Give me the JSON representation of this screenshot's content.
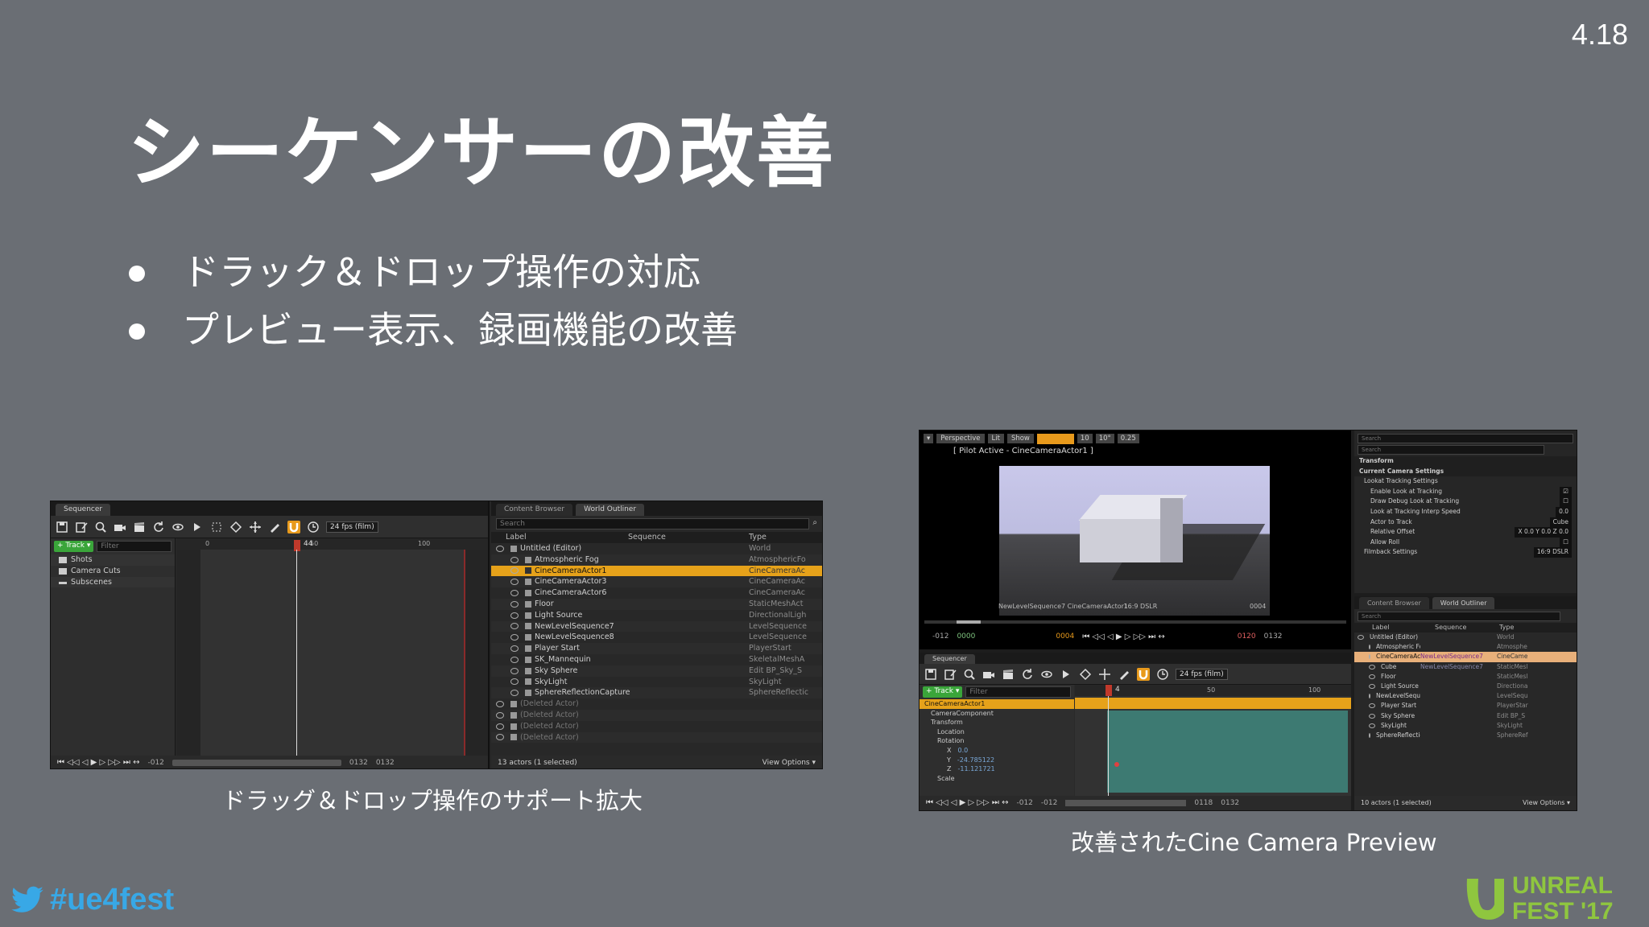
{
  "version": "4.18",
  "title": "シーケンサーの改善",
  "bullets": [
    "ドラック＆ドロップ操作の対応",
    "プレビュー表示、録画機能の改善"
  ],
  "captions": {
    "left": "ドラッグ＆ドロップ操作のサポート拡大",
    "right": "改善されたCine Camera Preview"
  },
  "hashtag": "#ue4fest",
  "logo_text": [
    "UNREAL",
    "FEST '17"
  ],
  "shot1": {
    "tabs": {
      "sequencer": "Sequencer",
      "content_browser": "Content Browser",
      "world_outliner": "World Outliner"
    },
    "fps": "24 fps (film)",
    "track_button": "+ Track ▾",
    "filter_placeholder": "Filter",
    "tracks": [
      "Shots",
      "Camera Cuts",
      "Subscenes"
    ],
    "ruler": {
      "start": "0",
      "frame": "44",
      "m50": "50",
      "m100": "100"
    },
    "timecodes": {
      "start": "-012",
      "end1": "0132",
      "end2": "0132"
    },
    "outliner": {
      "search_placeholder": "Search",
      "headers": {
        "label": "Label",
        "sequence": "Sequence",
        "type": "Type"
      },
      "rows": [
        {
          "label": "Untitled (Editor)",
          "type": "World",
          "indent": 0
        },
        {
          "label": "Atmospheric Fog",
          "type": "AtmosphericFo",
          "indent": 1
        },
        {
          "label": "CineCameraActor1",
          "type": "CineCameraAc",
          "indent": 1,
          "selected": true
        },
        {
          "label": "CineCameraActor3",
          "type": "CineCameraAc",
          "indent": 1
        },
        {
          "label": "CineCameraActor6",
          "type": "CineCameraAc",
          "indent": 1
        },
        {
          "label": "Floor",
          "type": "StaticMeshAct",
          "indent": 1
        },
        {
          "label": "Light Source",
          "type": "DirectionalLigh",
          "indent": 1
        },
        {
          "label": "NewLevelSequence7",
          "type": "LevelSequence",
          "indent": 1
        },
        {
          "label": "NewLevelSequence8",
          "type": "LevelSequence",
          "indent": 1
        },
        {
          "label": "Player Start",
          "type": "PlayerStart",
          "indent": 1
        },
        {
          "label": "SK_Mannequin",
          "type": "SkeletalMeshA",
          "indent": 1
        },
        {
          "label": "Sky Sphere",
          "type": "Edit BP_Sky_S",
          "indent": 1
        },
        {
          "label": "SkyLight",
          "type": "SkyLight",
          "indent": 1
        },
        {
          "label": "SphereReflectionCapture",
          "type": "SphereReflectic",
          "indent": 1
        },
        {
          "label": "(Deleted Actor)",
          "type": "",
          "indent": 0
        },
        {
          "label": "(Deleted Actor)",
          "type": "",
          "indent": 0
        },
        {
          "label": "(Deleted Actor)",
          "type": "",
          "indent": 0
        },
        {
          "label": "(Deleted Actor)",
          "type": "",
          "indent": 0
        }
      ],
      "status": "13 actors (1 selected)",
      "view_options": "View Options ▾"
    }
  },
  "shot2": {
    "viewport": {
      "perspective": "Perspective",
      "lit": "Lit",
      "show": "Show",
      "fov": "10°",
      "speed": "0.25",
      "grid": "10",
      "pilot": "[ Pilot Active - CineCameraActor1 ]",
      "overlay_left": "NewLevelSequence7  CineCameraActor1",
      "overlay_mid": "16:9 DSLR",
      "overlay_frame": "0004",
      "time_start": "-012",
      "time_green": "0000",
      "time_orange": "0004",
      "time_red": "0120",
      "time_end": "0132"
    },
    "details": {
      "search1": "Search",
      "search2": "Search",
      "sections": [
        {
          "label": "Transform",
          "kind": "section"
        },
        {
          "label": "Current Camera Settings",
          "kind": "section"
        },
        {
          "label": "Lookat Tracking Settings",
          "kind": "sub"
        },
        {
          "label": "Enable Look at Tracking",
          "kind": "prop",
          "value": "☑"
        },
        {
          "label": "Draw Debug Look at Tracking",
          "kind": "prop",
          "value": "☐"
        },
        {
          "label": "Look at Tracking Interp Speed",
          "kind": "prop",
          "value": "0.0"
        },
        {
          "label": "Actor to Track",
          "kind": "prop",
          "value": "Cube"
        },
        {
          "label": "Relative Offset",
          "kind": "prop",
          "value": "X 0.0  Y 0.0  Z 0.0"
        },
        {
          "label": "Allow Roll",
          "kind": "prop",
          "value": "☐"
        },
        {
          "label": "Filmback Settings",
          "kind": "sub",
          "value": "16:9 DSLR"
        }
      ]
    },
    "sequencer": {
      "tab": "Sequencer",
      "fps": "24 fps (film)",
      "track_button": "+ Track ▾",
      "filter_placeholder": "Filter",
      "tracks": [
        {
          "label": "CineCameraActor1",
          "kind": "actor"
        },
        {
          "label": "CameraComponent",
          "kind": "comp"
        },
        {
          "label": "Transform",
          "kind": "group"
        },
        {
          "label": "Location",
          "kind": "sub"
        },
        {
          "label": "Rotation",
          "kind": "sub"
        },
        {
          "label": "X",
          "value": "0.0",
          "kind": "val"
        },
        {
          "label": "Y",
          "value": "-24.785122",
          "kind": "val"
        },
        {
          "label": "Z",
          "value": "-11.121721",
          "kind": "val"
        },
        {
          "label": "Scale",
          "kind": "sub"
        }
      ],
      "ruler": {
        "frame": "4",
        "m50": "50",
        "m100": "100"
      },
      "timecodes": {
        "a": "-012",
        "b": "-012",
        "c": "0118",
        "d": "0132"
      }
    },
    "outliner": {
      "tabs": {
        "content_browser": "Content Browser",
        "world_outliner": "World Outliner"
      },
      "search_placeholder": "Search",
      "headers": {
        "label": "Label",
        "sequence": "Sequence",
        "type": "Type"
      },
      "rows": [
        {
          "label": "Untitled (Editor)",
          "seq": "",
          "type": "World",
          "indent": 0
        },
        {
          "label": "Atmospheric Fo",
          "seq": "",
          "type": "Atmosphe",
          "indent": 1
        },
        {
          "label": "CineCameraAct",
          "seq": "NewLevelSequence7",
          "type": "CineCame",
          "indent": 1,
          "selected": true
        },
        {
          "label": "Cube",
          "seq": "NewLevelSequence7",
          "type": "StaticMesl",
          "indent": 1
        },
        {
          "label": "Floor",
          "seq": "",
          "type": "StaticMesl",
          "indent": 1
        },
        {
          "label": "Light Source",
          "seq": "",
          "type": "Directiona",
          "indent": 1
        },
        {
          "label": "NewLevelSeque",
          "seq": "",
          "type": "LevelSequ",
          "indent": 1
        },
        {
          "label": "Player Start",
          "seq": "",
          "type": "PlayerStar",
          "indent": 1
        },
        {
          "label": "Sky Sphere",
          "seq": "",
          "type": "Edit BP_S",
          "indent": 1
        },
        {
          "label": "SkyLight",
          "seq": "",
          "type": "SkyLight",
          "indent": 1
        },
        {
          "label": "SphereReflectio",
          "seq": "",
          "type": "SphereRef",
          "indent": 1
        }
      ],
      "status": "10 actors (1 selected)",
      "view_options": "View Options ▾"
    }
  }
}
